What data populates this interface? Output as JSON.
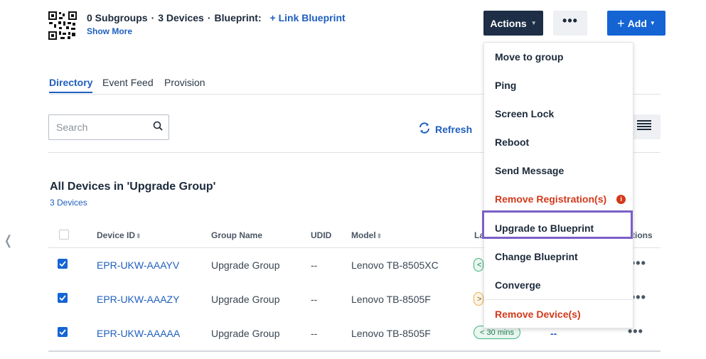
{
  "header": {
    "subgroups": "0 Subgroups",
    "devices": "3 Devices",
    "separator": "·",
    "blueprint_label": "Blueprint:",
    "link_blueprint": "+ Link Blueprint",
    "show_more": "Show More",
    "actions_label": "Actions",
    "more_label": "•••",
    "add_label": "Add"
  },
  "tabs": [
    {
      "label": "Directory",
      "active": true
    },
    {
      "label": "Event Feed",
      "active": false
    },
    {
      "label": "Provision",
      "active": false
    }
  ],
  "search": {
    "placeholder": "Search"
  },
  "refresh_label": "Refresh",
  "section": {
    "title": "All Devices in 'Upgrade Group'",
    "count": "3 Devices"
  },
  "table": {
    "columns": [
      "Device ID",
      "Group Name",
      "UDID",
      "Model",
      "La",
      "tions"
    ],
    "rows": [
      {
        "checked": true,
        "device_id": "EPR-UKW-AAAYV",
        "group": "Upgrade Group",
        "udid": "--",
        "model": "Lenovo TB-8505XC",
        "last": "<",
        "last_style": "green",
        "bp": ""
      },
      {
        "checked": true,
        "device_id": "EPR-UKW-AAAZY",
        "group": "Upgrade Group",
        "udid": "--",
        "model": "Lenovo TB-8505F",
        "last": ">",
        "last_style": "yellow",
        "bp": ""
      },
      {
        "checked": true,
        "device_id": "EPR-UKW-AAAAA",
        "group": "Upgrade Group",
        "udid": "--",
        "model": "Lenovo TB-8505F",
        "last": "< 30 mins",
        "last_style": "green",
        "bp": "--"
      }
    ]
  },
  "menu": {
    "items": [
      {
        "label": "Move to group",
        "danger": false
      },
      {
        "label": "Ping",
        "danger": false
      },
      {
        "label": "Screen Lock",
        "danger": false
      },
      {
        "label": "Reboot",
        "danger": false
      },
      {
        "label": "Send Message",
        "danger": false
      },
      {
        "label": "Remove Registration(s)",
        "danger": true
      },
      {
        "label": "Upgrade to Blueprint",
        "danger": false,
        "highlighted": true
      },
      {
        "label": "Change Blueprint",
        "danger": false
      },
      {
        "label": "Converge",
        "danger": false
      },
      {
        "label": "Remove Device(s)",
        "danger": true
      }
    ],
    "info_glyph": "i"
  },
  "colors": {
    "primary": "#1464d4",
    "actions_bg": "#1d2e46",
    "danger": "#d2391a",
    "highlight": "#7b5fc7"
  }
}
